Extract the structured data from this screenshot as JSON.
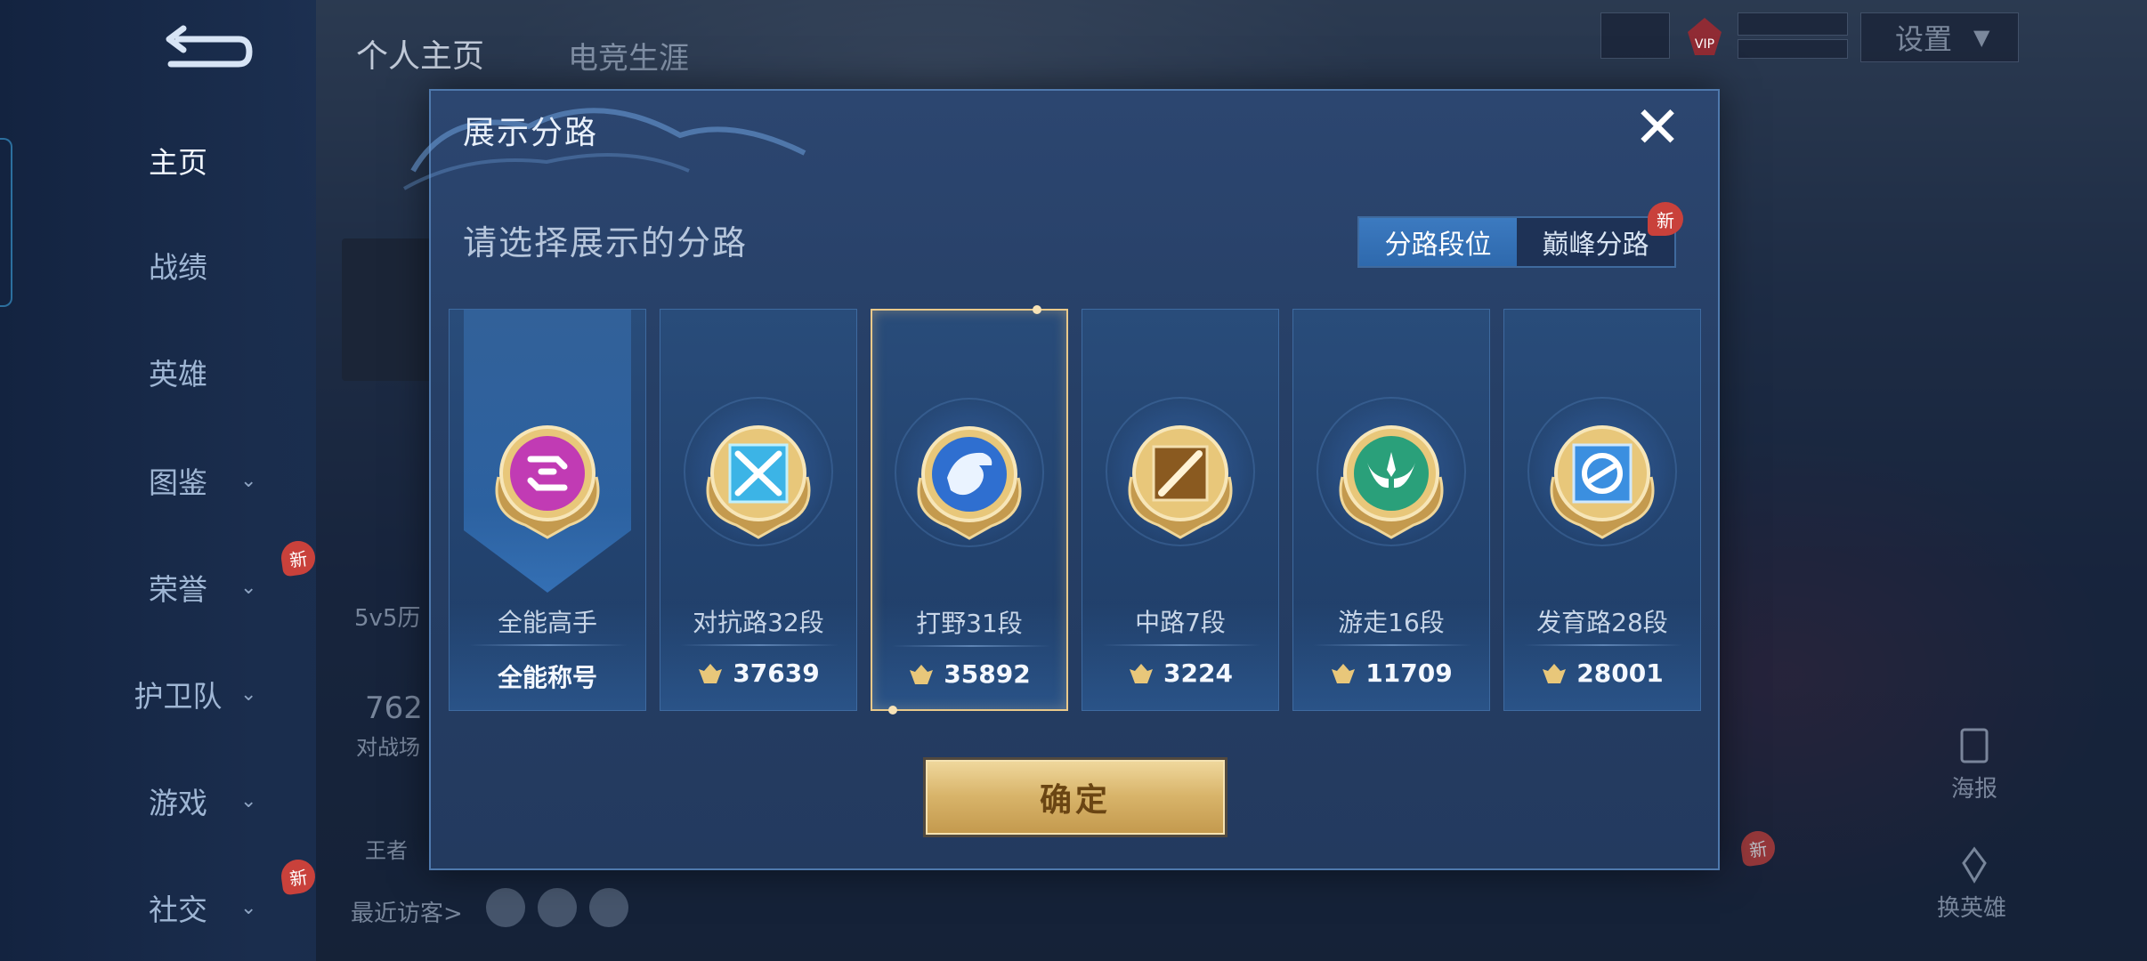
{
  "sidebar": {
    "items": [
      {
        "label": "主页",
        "active": true
      },
      {
        "label": "战绩"
      },
      {
        "label": "英雄"
      },
      {
        "label": "图鉴",
        "chevron": "chevron-down-icon"
      },
      {
        "label": "荣誉",
        "chevron": "chevron-down-icon",
        "badge": "新"
      },
      {
        "label": "护卫队",
        "chevron": "chevron-down-icon"
      },
      {
        "label": "游戏",
        "chevron": "chevron-down-icon"
      },
      {
        "label": "社交",
        "chevron": "chevron-down-icon",
        "badge": "新"
      }
    ]
  },
  "background": {
    "tab_profile": "个人主页",
    "tab_esports": "电竞生涯",
    "settings_label": "设置",
    "vip_label": "VIP",
    "mode_text": "5v5历",
    "count_text": "762",
    "battle_text": "对战场",
    "king_text": "王者",
    "recent_visitors": "最近访客>",
    "poster_label": "海报",
    "switch_hero_label": "换英雄",
    "new_badge": "新"
  },
  "modal": {
    "title": "展示分路",
    "prompt": "请选择展示的分路",
    "toggle": {
      "option_rank": "分路段位",
      "option_peak": "巅峰分路",
      "peak_badge": "新",
      "active": "分路段位"
    },
    "cards": [
      {
        "name": "全能高手",
        "score": "全能称号",
        "emblem": "all-round-emblem-icon",
        "color": "#c13bb4"
      },
      {
        "name": "对抗路32段",
        "score": "37639",
        "emblem": "clash-lane-emblem-icon",
        "color": "#3cb4e6"
      },
      {
        "name": "打野31段",
        "score": "35892",
        "emblem": "jungle-dragon-emblem-icon",
        "color": "#2f6fd0",
        "selected": true
      },
      {
        "name": "中路7段",
        "score": "3224",
        "emblem": "mid-lane-emblem-icon",
        "color": "#8a5a20"
      },
      {
        "name": "游走16段",
        "score": "11709",
        "emblem": "roam-wings-emblem-icon",
        "color": "#2aa07a"
      },
      {
        "name": "发育路28段",
        "score": "28001",
        "emblem": "farm-lane-emblem-icon",
        "color": "#3b8fe0"
      }
    ],
    "confirm_label": "确定"
  },
  "colors": {
    "accent_gold": "#d8b46a",
    "toggle_active": "#2e69ad",
    "badge_red": "#c9413b",
    "selected_border": "#e9c98a"
  }
}
